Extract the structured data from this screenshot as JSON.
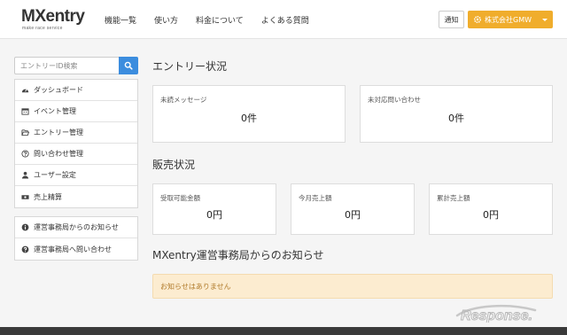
{
  "header": {
    "logo": {
      "name": "MXentry",
      "tagline": "make race service"
    },
    "nav": [
      "機能一覧",
      "使い方",
      "料金について",
      "よくある質問"
    ],
    "notice_label": "通知",
    "company_label": "株式会社GMW"
  },
  "sidebar": {
    "search": {
      "placeholder": "エントリーID検索",
      "value": ""
    },
    "menu": [
      {
        "label": "ダッシュボード",
        "icon": "dashboard-icon"
      },
      {
        "label": "イベント管理",
        "icon": "calendar-icon"
      },
      {
        "label": "エントリー管理",
        "icon": "folder-open-icon"
      },
      {
        "label": "問い合わせ管理",
        "icon": "question-circle-icon"
      },
      {
        "label": "ユーザー設定",
        "icon": "user-icon"
      },
      {
        "label": "売上精算",
        "icon": "money-icon"
      }
    ],
    "menu_secondary": [
      {
        "label": "運営事務局からのお知らせ",
        "icon": "info-circle-icon"
      },
      {
        "label": "運営事務局へ問い合わせ",
        "icon": "question-circle-icon"
      }
    ]
  },
  "main": {
    "entry_status": {
      "title": "エントリー状況",
      "cards": [
        {
          "label": "未読メッセージ",
          "value": "0件"
        },
        {
          "label": "未対応問い合わせ",
          "value": "0件"
        }
      ]
    },
    "sales_status": {
      "title": "販売状況",
      "cards": [
        {
          "label": "受取可能金額",
          "value": "0円"
        },
        {
          "label": "今月売上額",
          "value": "0円"
        },
        {
          "label": "累計売上額",
          "value": "0円"
        }
      ]
    },
    "news": {
      "title": "MXentry運営事務局からのお知らせ",
      "empty_message": "お知らせはありません"
    }
  },
  "watermark": "Response.",
  "colors": {
    "accent_orange": "#f0ad2c",
    "search_blue": "#3c8dde",
    "alert_bg": "#fcecd0",
    "alert_text": "#b07a2a"
  }
}
